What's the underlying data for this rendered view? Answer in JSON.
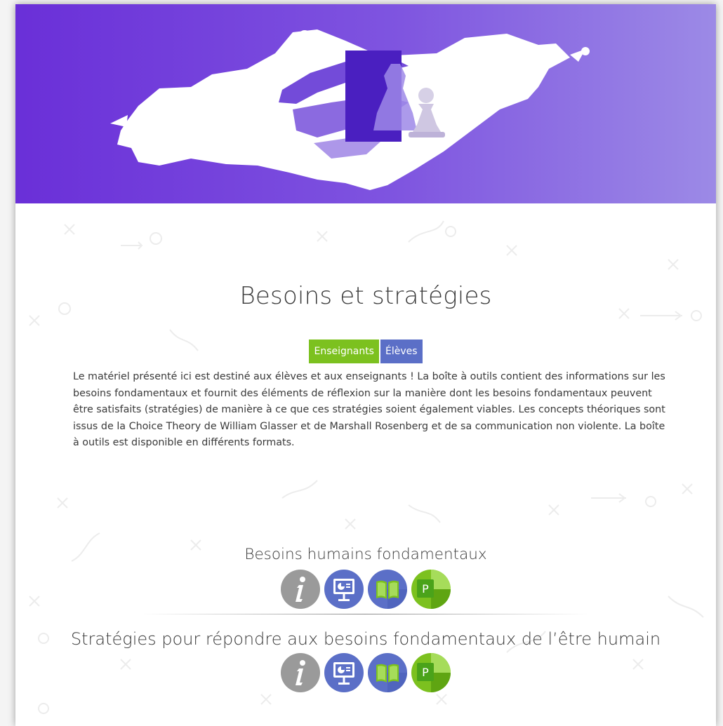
{
  "page": {
    "title": "Besoins et stratégies",
    "tags": [
      {
        "label": "Enseignants",
        "color": "#7cc11f"
      },
      {
        "label": "Élèves",
        "color": "#5b6fc7"
      }
    ],
    "description": "Le matériel présenté ici est destiné aux élèves et aux enseignants ! La boîte à outils contient des informations sur les besoins fondamentaux et fournit des éléments de réflexion sur la manière dont les besoins fondamentaux peuvent être satisfaits (stratégies) de manière à ce que ces stratégies soient également viables. Les concepts théoriques sont issus de la Choice Theory de William Glasser et de Marshall Rosenberg et de sa communication non violente. La boîte à outils est disponible en différents formats."
  },
  "sections": [
    {
      "title": "Besoins humains fondamentaux",
      "icons": [
        "info-icon",
        "presentation-icon",
        "book-icon",
        "powerpoint-icon"
      ]
    },
    {
      "title": "Stratégies pour répondre aux besoins fondamentaux de l’être humain",
      "icons": [
        "info-icon",
        "presentation-icon",
        "book-icon",
        "powerpoint-icon"
      ]
    }
  ],
  "colors": {
    "banner_start": "#6a2fd8",
    "banner_end": "#9c8ae6",
    "green": "#7cc11f",
    "blue": "#5b6fc7",
    "grey": "#9a9a9a"
  }
}
